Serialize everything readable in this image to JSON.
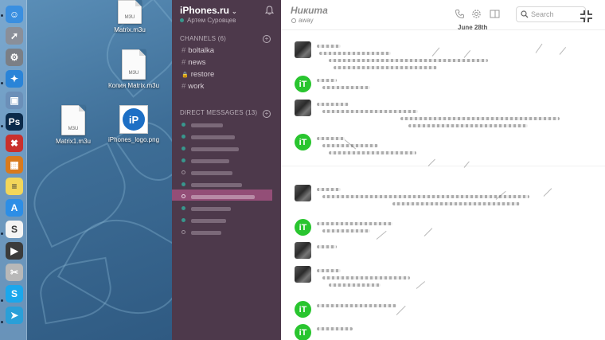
{
  "desktop": {
    "dock_icons": [
      {
        "name": "finder-icon",
        "color": "#3a8fe0",
        "glyph": "☺"
      },
      {
        "name": "launchpad-icon",
        "color": "#8a8f99",
        "glyph": "➚"
      },
      {
        "name": "system-preferences-icon",
        "color": "#7b7f86",
        "glyph": "⚙"
      },
      {
        "name": "safari-icon",
        "color": "#2a84d8",
        "glyph": "✦"
      },
      {
        "name": "preview-icon",
        "color": "#6b8fb8",
        "glyph": "▣"
      },
      {
        "name": "photoshop-icon",
        "color": "#0b2a4a",
        "glyph": "Ps"
      },
      {
        "name": "crossover-icon",
        "color": "#c9302c",
        "glyph": "✖"
      },
      {
        "name": "calculator-icon",
        "color": "#d97a1d",
        "glyph": "▦"
      },
      {
        "name": "notes-icon",
        "color": "#f2d65a",
        "glyph": "≡"
      },
      {
        "name": "app-store-icon",
        "color": "#2d8ee6",
        "glyph": "A"
      },
      {
        "name": "slack-icon",
        "color": "#f4f4f4",
        "glyph": "S"
      },
      {
        "name": "final-cut-icon",
        "color": "#3b3b3b",
        "glyph": "▶"
      },
      {
        "name": "script-icon",
        "color": "#b8b8b8",
        "glyph": "✂"
      },
      {
        "name": "skype-icon",
        "color": "#1ba7ec",
        "glyph": "S"
      },
      {
        "name": "telegram-icon",
        "color": "#2a9fd8",
        "glyph": "➤"
      }
    ],
    "files": [
      {
        "label": "Matrix.m3u",
        "ext": "M3U"
      },
      {
        "label": "Копия Matrix.m3u",
        "ext": "M3U"
      },
      {
        "label": "Matrix1.m3u",
        "ext": "M3U"
      },
      {
        "label": "iPhones_logo.png",
        "logo_text": "iP"
      }
    ]
  },
  "sidebar": {
    "team_name": "iPhones.ru",
    "caret": "⌄",
    "user_name": "Артем Суровцев",
    "channels_header": "CHANNELS",
    "channels_count": "(6)",
    "channels": [
      {
        "prefix": "#",
        "name": "boltalka"
      },
      {
        "prefix": "#",
        "name": "news"
      },
      {
        "prefix": "🔒",
        "name": "restore"
      },
      {
        "prefix": "#",
        "name": "work"
      }
    ],
    "dm_header": "DIRECT MESSAGES",
    "dm_count": "(13)"
  },
  "chat": {
    "title": "Никита",
    "status": "away",
    "search_placeholder": "Search",
    "day_divider": "June 28th"
  },
  "colors": {
    "sidebar_bg": "#4d394b",
    "presence_green": "#38978d",
    "active_dm": "#a0527f",
    "avatar_green": "#29c52f"
  }
}
